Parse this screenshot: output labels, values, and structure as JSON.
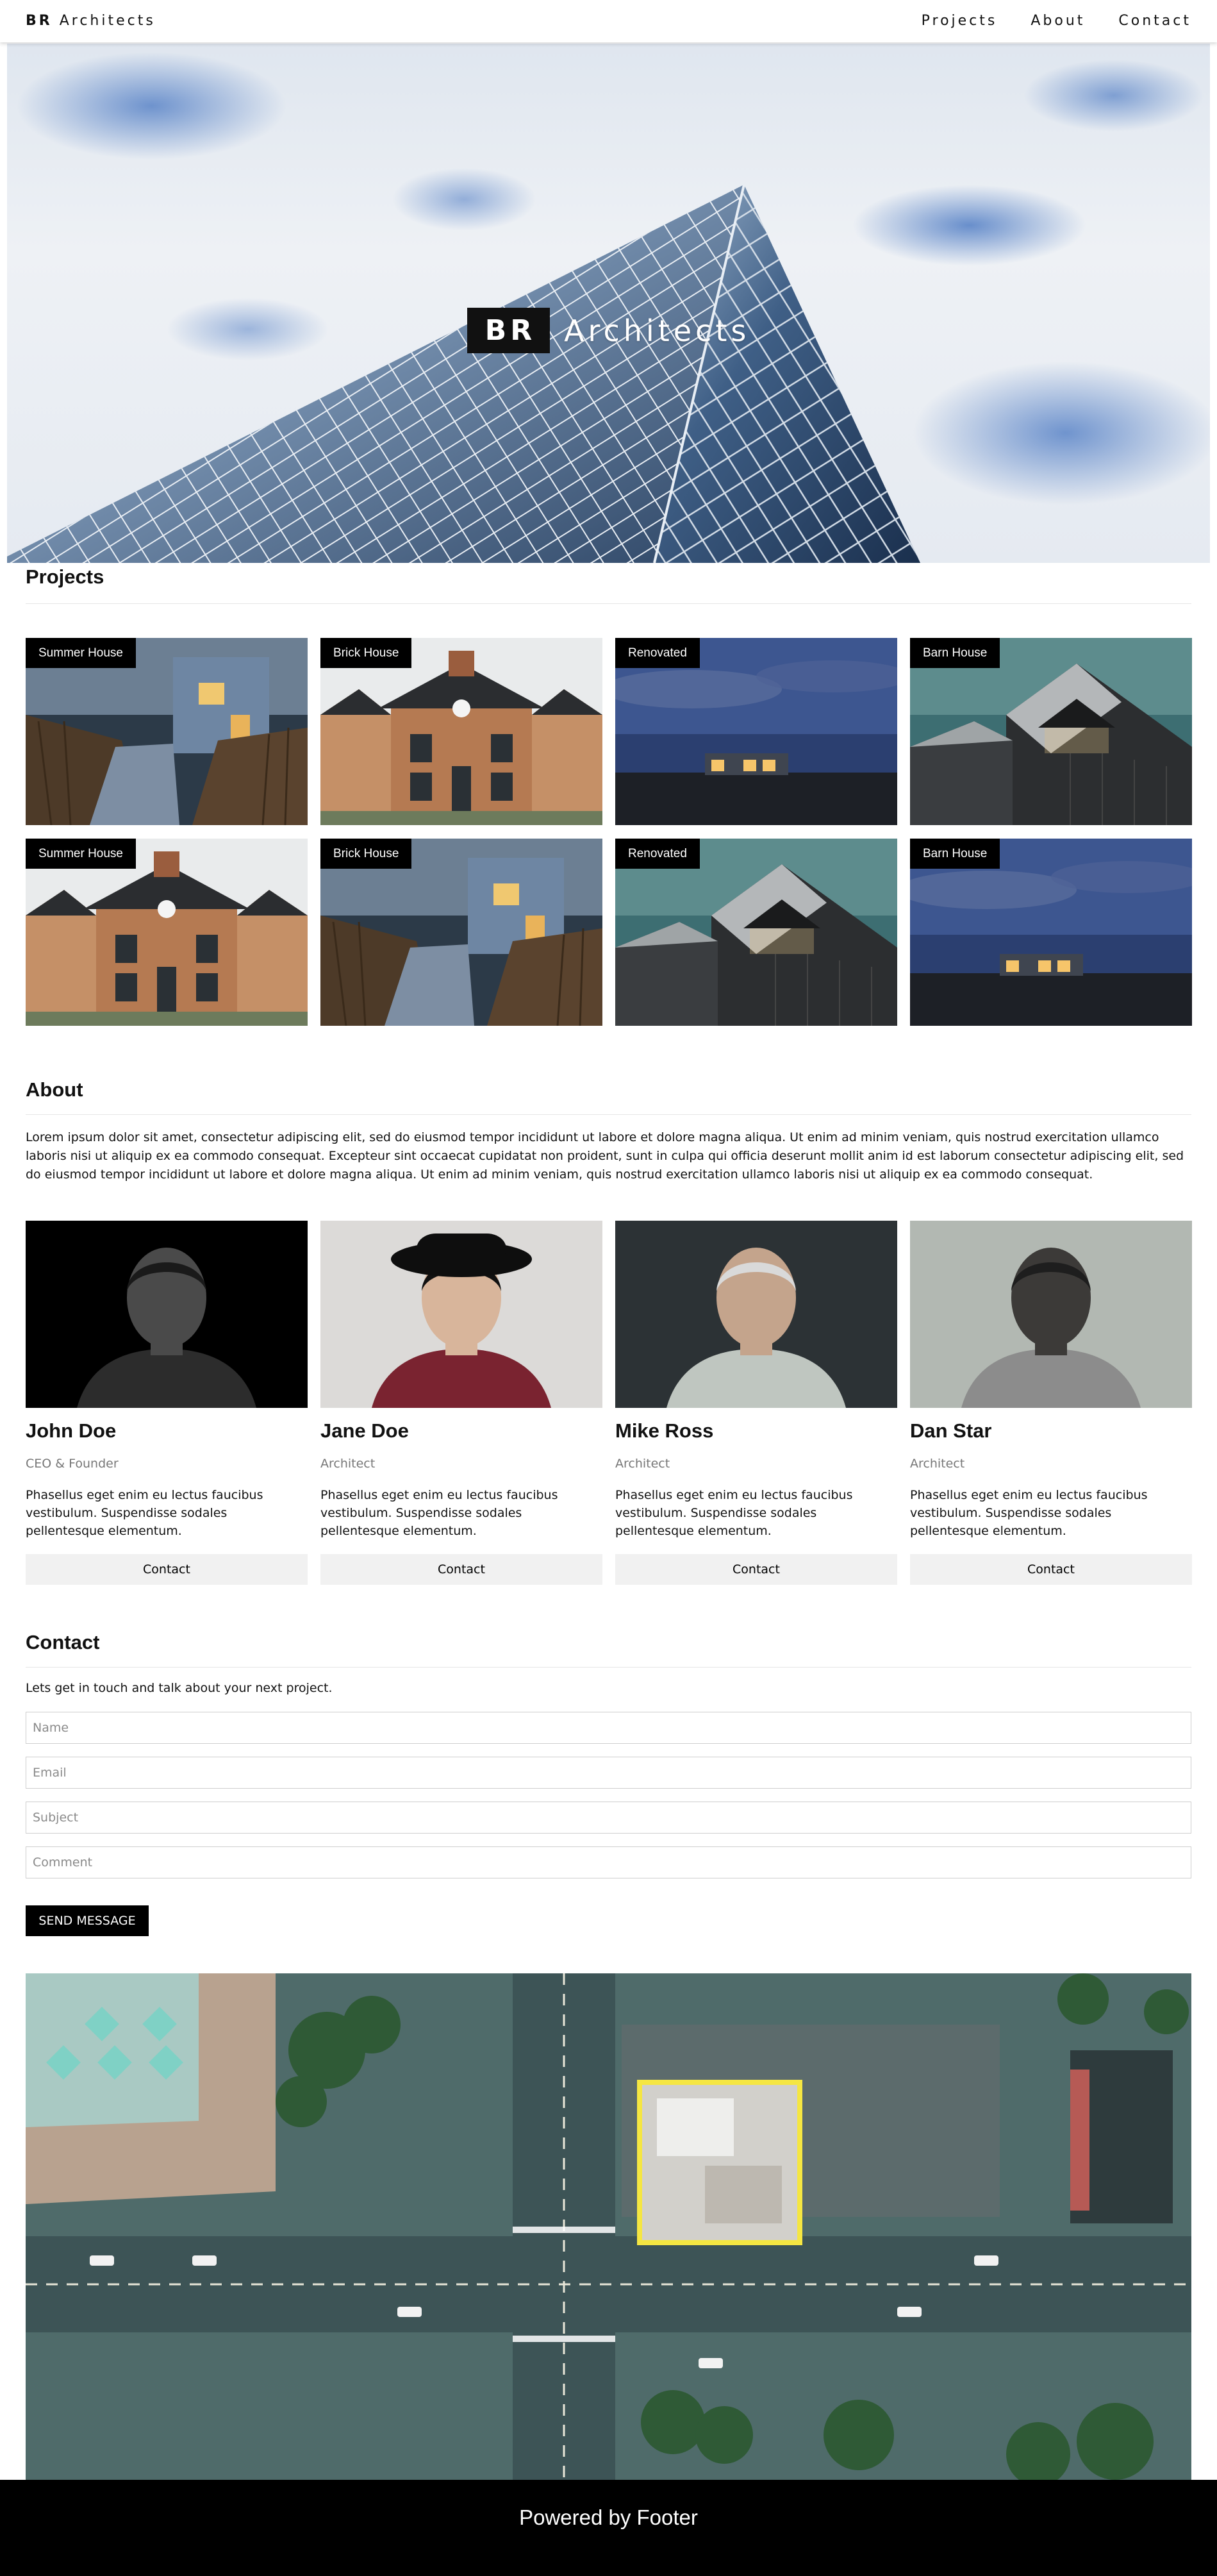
{
  "navbar": {
    "brand_bold": "BR",
    "brand_rest": " Architects",
    "links": [
      "Projects",
      "About",
      "Contact"
    ]
  },
  "hero": {
    "badge": "BR",
    "title": "Architects"
  },
  "projects": {
    "title": "Projects",
    "items": [
      {
        "label": "Summer House",
        "image": "boardwalk-house-dusk"
      },
      {
        "label": "Brick House",
        "image": "brick-townhouses"
      },
      {
        "label": "Renovated",
        "image": "house-at-night-landscape"
      },
      {
        "label": "Barn House",
        "image": "modern-barn-house"
      },
      {
        "label": "Summer House",
        "image": "brick-townhouses"
      },
      {
        "label": "Brick House",
        "image": "boardwalk-house-dusk"
      },
      {
        "label": "Renovated",
        "image": "modern-barn-house"
      },
      {
        "label": "Barn House",
        "image": "house-at-night-landscape"
      }
    ]
  },
  "about": {
    "title": "About",
    "text": "Lorem ipsum dolor sit amet, consectetur adipiscing elit, sed do eiusmod tempor incididunt ut labore et dolore magna aliqua. Ut enim ad minim veniam, quis nostrud exercitation ullamco laboris nisi ut aliquip ex ea commodo consequat. Excepteur sint occaecat cupidatat non proident, sunt in culpa qui officia deserunt mollit anim id est laborum consectetur adipiscing elit, sed do eiusmod tempor incididunt ut labore et dolore magna aliqua. Ut enim ad minim veniam, quis nostrud exercitation ullamco laboris nisi ut aliquip ex ea commodo consequat.",
    "team": [
      {
        "name": "John Doe",
        "role": "CEO & Founder",
        "desc": "Phasellus eget enim eu lectus faucibus vestibulum. Suspendisse sodales pellentesque elementum.",
        "button": "Contact"
      },
      {
        "name": "Jane Doe",
        "role": "Architect",
        "desc": "Phasellus eget enim eu lectus faucibus vestibulum. Suspendisse sodales pellentesque elementum.",
        "button": "Contact"
      },
      {
        "name": "Mike Ross",
        "role": "Architect",
        "desc": "Phasellus eget enim eu lectus faucibus vestibulum. Suspendisse sodales pellentesque elementum.",
        "button": "Contact"
      },
      {
        "name": "Dan Star",
        "role": "Architect",
        "desc": "Phasellus eget enim eu lectus faucibus vestibulum. Suspendisse sodales pellentesque elementum.",
        "button": "Contact"
      }
    ]
  },
  "contact": {
    "title": "Contact",
    "intro": "Lets get in touch and talk about your next project.",
    "placeholders": {
      "name": "Name",
      "email": "Email",
      "subject": "Subject",
      "comment": "Comment"
    },
    "send": "SEND MESSAGE"
  },
  "footer": {
    "text": "Powered by Footer"
  },
  "colors": {
    "accent": "#000000",
    "button_bg": "#f1f1f1",
    "role_text": "#777777"
  }
}
